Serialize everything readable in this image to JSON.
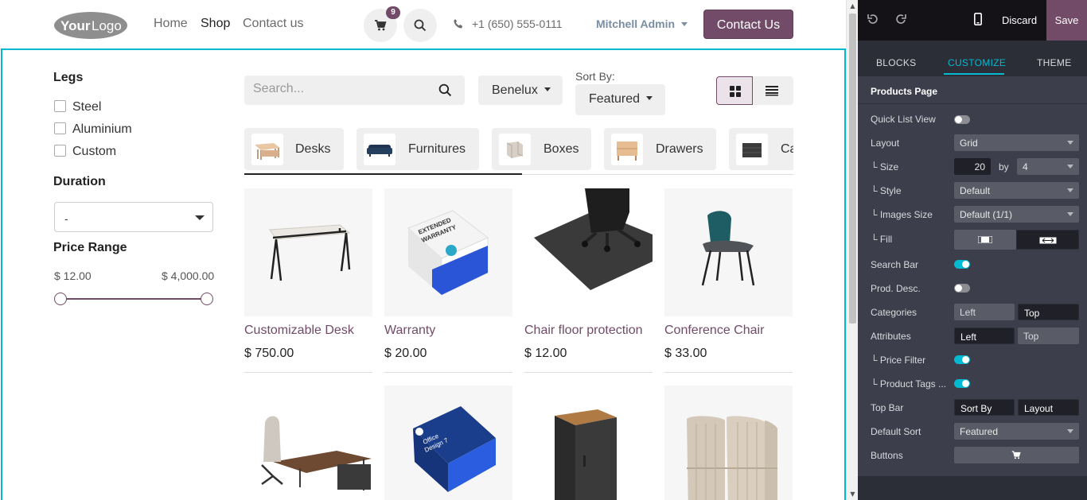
{
  "header": {
    "nav": [
      "Home",
      "Shop",
      "Contact us"
    ],
    "cart_count": "9",
    "phone": "+1 (650) 555-0111",
    "user": "Mitchell Admin",
    "contact_button": "Contact Us"
  },
  "filters": {
    "legs_title": "Legs",
    "legs_options": [
      "Steel",
      "Aluminium",
      "Custom"
    ],
    "duration_title": "Duration",
    "duration_value": "-",
    "price_title": "Price Range",
    "price_min": "$ 12.00",
    "price_max": "$ 4,000.00"
  },
  "toolbar": {
    "search_placeholder": "Search...",
    "pricelist": "Benelux",
    "sort_label": "Sort By:",
    "sort_value": "Featured"
  },
  "categories": [
    "Desks",
    "Furnitures",
    "Boxes",
    "Drawers",
    "Ca"
  ],
  "products": [
    {
      "name": "Customizable Desk",
      "price": "$ 750.00"
    },
    {
      "name": "Warranty",
      "price": "$ 20.00"
    },
    {
      "name": "Chair floor protection",
      "price": "$ 12.00"
    },
    {
      "name": "Conference Chair",
      "price": "$ 33.00"
    }
  ],
  "editor": {
    "discard": "Discard",
    "save": "Save",
    "tabs": [
      "BLOCKS",
      "CUSTOMIZE",
      "THEME"
    ],
    "section_title": "Products Page",
    "rows": {
      "quick_list_view": "Quick List View",
      "layout": "Layout",
      "layout_value": "Grid",
      "size": "└ Size",
      "size_value": "20",
      "size_by": "by",
      "size_cols": "4",
      "style": "└ Style",
      "style_value": "Default",
      "images_size": "└ Images Size",
      "images_size_value": "Default (1/1)",
      "fill": "└ Fill",
      "search_bar": "Search Bar",
      "prod_desc": "Prod. Desc.",
      "categories": "Categories",
      "categories_left": "Left",
      "categories_top": "Top",
      "attributes": "Attributes",
      "attributes_left": "Left",
      "attributes_top": "Top",
      "price_filter": "└ Price Filter",
      "product_tags": "└ Product Tags ...",
      "top_bar": "Top Bar",
      "top_bar_sort": "Sort By",
      "top_bar_layout": "Layout",
      "default_sort": "Default Sort",
      "default_sort_value": "Featured",
      "buttons": "Buttons"
    }
  }
}
